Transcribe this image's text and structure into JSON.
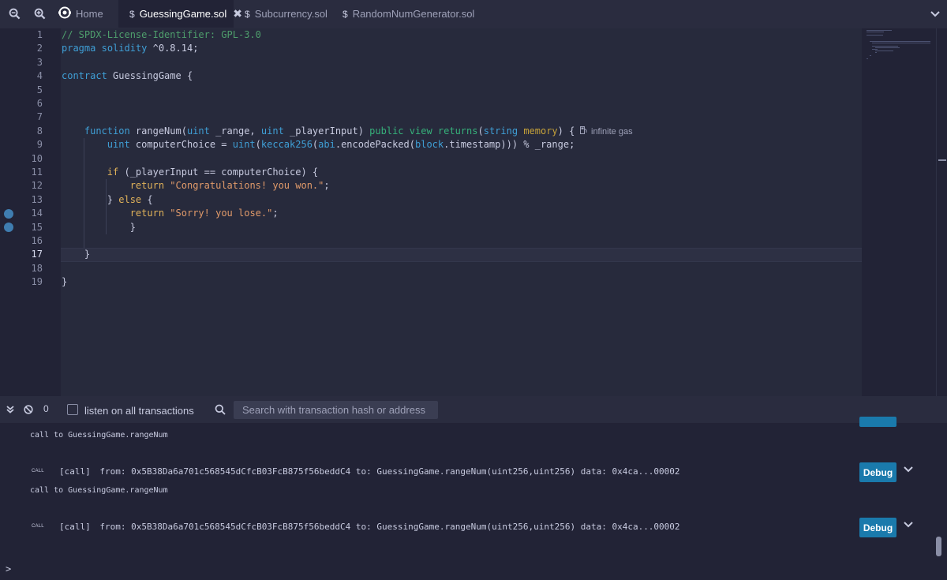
{
  "tabs": {
    "zoom_out_icon": "zoom-out-icon",
    "zoom_in_icon": "zoom-in-icon",
    "items": [
      {
        "label": "Home",
        "icon": "remix-logo-icon",
        "active": false,
        "closable": false
      },
      {
        "label": "GuessingGame.sol",
        "icon": "solidity-icon",
        "active": true,
        "closable": true,
        "close_glyph": "✖"
      },
      {
        "label": "Subcurrency.sol",
        "icon": "solidity-icon",
        "active": false,
        "closable": false
      },
      {
        "label": "RandomNumGenerator.sol",
        "icon": "solidity-icon",
        "active": false,
        "closable": false
      }
    ],
    "overflow_icon": "chevron-down-icon"
  },
  "editor": {
    "current_line": 17,
    "breakpoints": [
      14,
      15
    ],
    "lines": [
      {
        "n": "1",
        "text": "// SPDX-License-Identifier: GPL-3.0"
      },
      {
        "n": "2",
        "text": "pragma solidity ^0.8.14;"
      },
      {
        "n": "3",
        "text": ""
      },
      {
        "n": "4",
        "text": "contract GuessingGame {"
      },
      {
        "n": "5",
        "text": ""
      },
      {
        "n": "6",
        "text": ""
      },
      {
        "n": "7",
        "text": ""
      },
      {
        "n": "8",
        "text": "    function rangeNum(uint _range, uint _playerInput) public view returns(string memory) {"
      },
      {
        "n": "9",
        "text": "        uint computerChoice = uint(keccak256(abi.encodePacked(block.timestamp))) % _range;"
      },
      {
        "n": "10",
        "text": ""
      },
      {
        "n": "11",
        "text": "        if (_playerInput == computerChoice) {"
      },
      {
        "n": "12",
        "text": "            return \"Congratulations! you won.\";"
      },
      {
        "n": "13",
        "text": "        } else {"
      },
      {
        "n": "14",
        "text": "            return \"Sorry! you lose.\";"
      },
      {
        "n": "15",
        "text": "            }"
      },
      {
        "n": "16",
        "text": ""
      },
      {
        "n": "17",
        "text": "    }"
      },
      {
        "n": "18",
        "text": ""
      },
      {
        "n": "19",
        "text": "}"
      }
    ],
    "gas_estimate": "infinite gas",
    "gas_icon": "fuel-pump-icon"
  },
  "terminal_bar": {
    "collapse_icon": "double-chevron-down-icon",
    "clear_icon": "clear-circle-icon",
    "pending_count": "0",
    "listen_label": "listen on all transactions",
    "listen_checked": false,
    "search_icon": "search-icon",
    "search_placeholder": "Search with transaction hash or address",
    "search_value": ""
  },
  "terminal": {
    "entries": [
      {
        "call_to": "call to GuessingGame.rangeNum",
        "badge": "CALL",
        "tag": "[call]",
        "from_label": "from:",
        "from": "0x5B38Da6a701c568545dCfcB03FcB875f56beddC4",
        "to_label": "to:",
        "to": "GuessingGame.rangeNum(uint256,uint256)",
        "data_label": "data:",
        "data": "0x4ca...00002",
        "debug_label": "Debug"
      },
      {
        "call_to": "call to GuessingGame.rangeNum",
        "badge": "CALL",
        "tag": "[call]",
        "from_label": "from:",
        "from": "0x5B38Da6a701c568545dCfcB03FcB875f56beddC4",
        "to_label": "to:",
        "to": "GuessingGame.rangeNum(uint256,uint256)",
        "data_label": "data:",
        "data": "0x4ca...00002",
        "debug_label": "Debug"
      }
    ],
    "prompt": ">"
  },
  "colors": {
    "accent": "#1a7aac",
    "editor_bg": "#272a3c",
    "panel_bg": "#222336",
    "keyword": "#3f9fd6",
    "string": "#e09a6a",
    "comment": "#4e9e6c",
    "breakpoint": "#3f7db0"
  }
}
